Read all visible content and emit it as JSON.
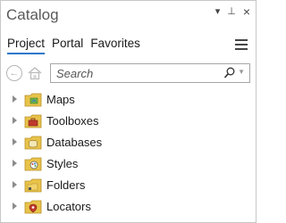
{
  "panel": {
    "title": "Catalog",
    "controls": {
      "dropdown_glyph": "▾",
      "pin_glyph": "⊥",
      "close_glyph": "×"
    }
  },
  "tabs": [
    {
      "label": "Project",
      "active": true
    },
    {
      "label": "Portal",
      "active": false
    },
    {
      "label": "Favorites",
      "active": false
    }
  ],
  "nav": {
    "back_glyph": "←"
  },
  "search": {
    "placeholder": "Search"
  },
  "tree": {
    "items": [
      {
        "label": "Maps",
        "icon": "maps-folder-icon"
      },
      {
        "label": "Toolboxes",
        "icon": "toolboxes-folder-icon"
      },
      {
        "label": "Databases",
        "icon": "databases-folder-icon"
      },
      {
        "label": "Styles",
        "icon": "styles-folder-icon"
      },
      {
        "label": "Folders",
        "icon": "folders-folder-icon"
      },
      {
        "label": "Locators",
        "icon": "locators-folder-icon"
      }
    ]
  },
  "colors": {
    "accent": "#2b78c8",
    "folder": "#e8c34a"
  }
}
